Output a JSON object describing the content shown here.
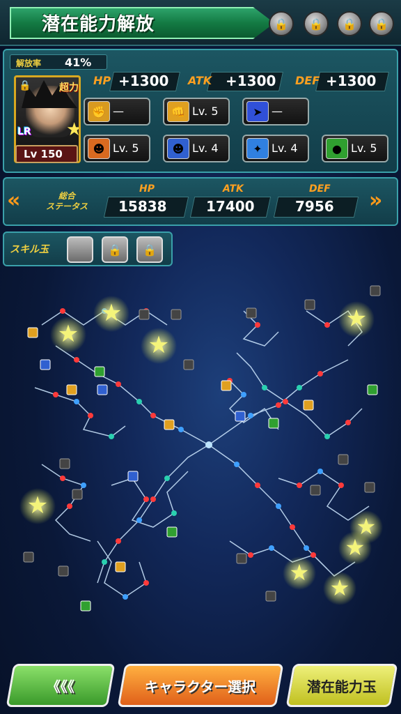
{
  "header": {
    "title": "潜在能力解放",
    "locks": [
      "lock-icon",
      "lock-icon",
      "lock-icon",
      "lock-icon"
    ]
  },
  "status": {
    "release_label": "解放率",
    "release_value": "41%",
    "level": "Lv 150",
    "super_badge": "超力",
    "lr_badge": "LR",
    "stats": [
      {
        "name": "HP",
        "value": "+1300"
      },
      {
        "name": "ATK",
        "value": "+1300"
      },
      {
        "name": "DEF",
        "value": "+1300"
      }
    ],
    "skills_row1": [
      {
        "icon": "punch-icon",
        "text": "—",
        "color": "#d89a20"
      },
      {
        "icon": "fist-icon",
        "text": "Lv. 5",
        "color": "#e0a020"
      },
      {
        "icon": "dash-icon",
        "text": "—",
        "color": "#3050d8"
      }
    ],
    "skills_row2": [
      {
        "icon": "character-icon",
        "text": "Lv. 5",
        "color": "#d86a20"
      },
      {
        "icon": "character-icon",
        "text": "Lv. 4",
        "color": "#3060d0"
      },
      {
        "icon": "energy-icon",
        "text": "Lv. 4",
        "color": "#3080e0"
      },
      {
        "icon": "green-orb-icon",
        "text": "Lv. 5",
        "color": "#30a030"
      }
    ]
  },
  "total": {
    "label_line1": "総合",
    "label_line2": "ステータス",
    "stats": [
      {
        "name": "HP",
        "value": "15838"
      },
      {
        "name": "ATK",
        "value": "17400"
      },
      {
        "name": "DEF",
        "value": "7956"
      }
    ]
  },
  "skill_orbs": {
    "label": "スキル玉"
  },
  "buttons": {
    "back": "《《《",
    "character_select": "キャラクター選択",
    "potential_orb": "潜在能力玉"
  },
  "colors": {
    "accent_orange": "#ff9a1a",
    "accent_green": "#2da36a",
    "panel_teal": "#1c5662"
  }
}
